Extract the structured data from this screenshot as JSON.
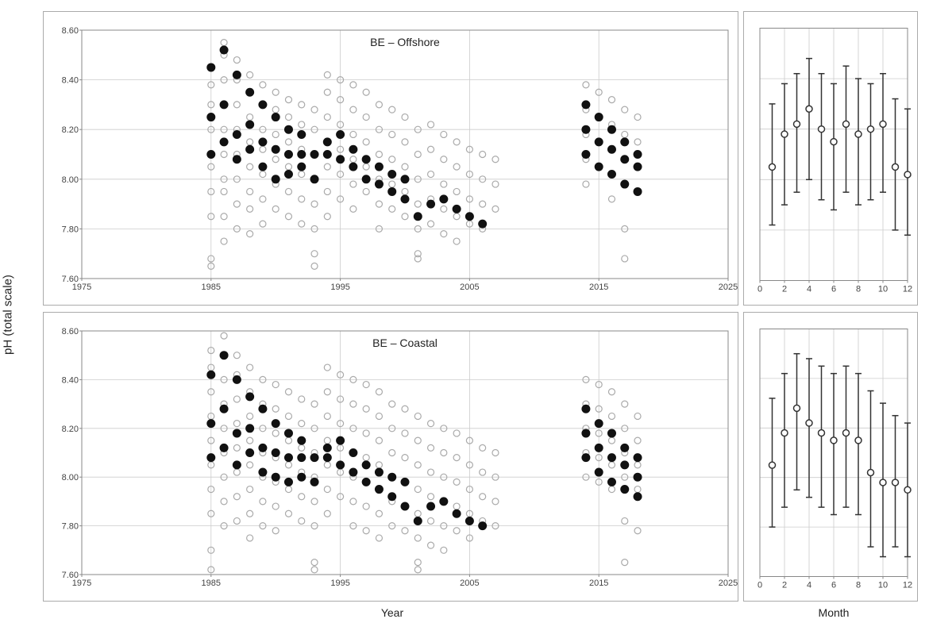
{
  "ylabel": "pH (total scale)",
  "xlabel_main": "Year",
  "xlabel_side": "Month",
  "top_chart": {
    "title": "BE – Offshore",
    "y_min": 7.6,
    "y_max": 8.6,
    "x_min": 1975,
    "x_max": 2025,
    "y_ticks": [
      7.6,
      7.8,
      8.0,
      8.2,
      8.4,
      8.6
    ],
    "x_ticks": [
      1975,
      1985,
      1995,
      2005,
      2015,
      2025
    ]
  },
  "bottom_chart": {
    "title": "BE – Coastal",
    "y_min": 7.6,
    "y_max": 8.6,
    "x_min": 1975,
    "x_max": 2025,
    "y_ticks": [
      7.6,
      7.8,
      8.0,
      8.2,
      8.4,
      8.6
    ],
    "x_ticks": [
      1975,
      1985,
      1995,
      2005,
      2015,
      2025
    ]
  },
  "side_top": {
    "x_min": 0,
    "x_max": 12,
    "x_ticks": [
      0,
      2,
      4,
      6,
      8,
      10,
      12
    ],
    "y_min": 7.6,
    "y_max": 8.6
  },
  "side_bottom": {
    "x_min": 0,
    "x_max": 12,
    "x_ticks": [
      0,
      2,
      4,
      6,
      8,
      10,
      12
    ],
    "y_min": 7.6,
    "y_max": 8.6
  }
}
